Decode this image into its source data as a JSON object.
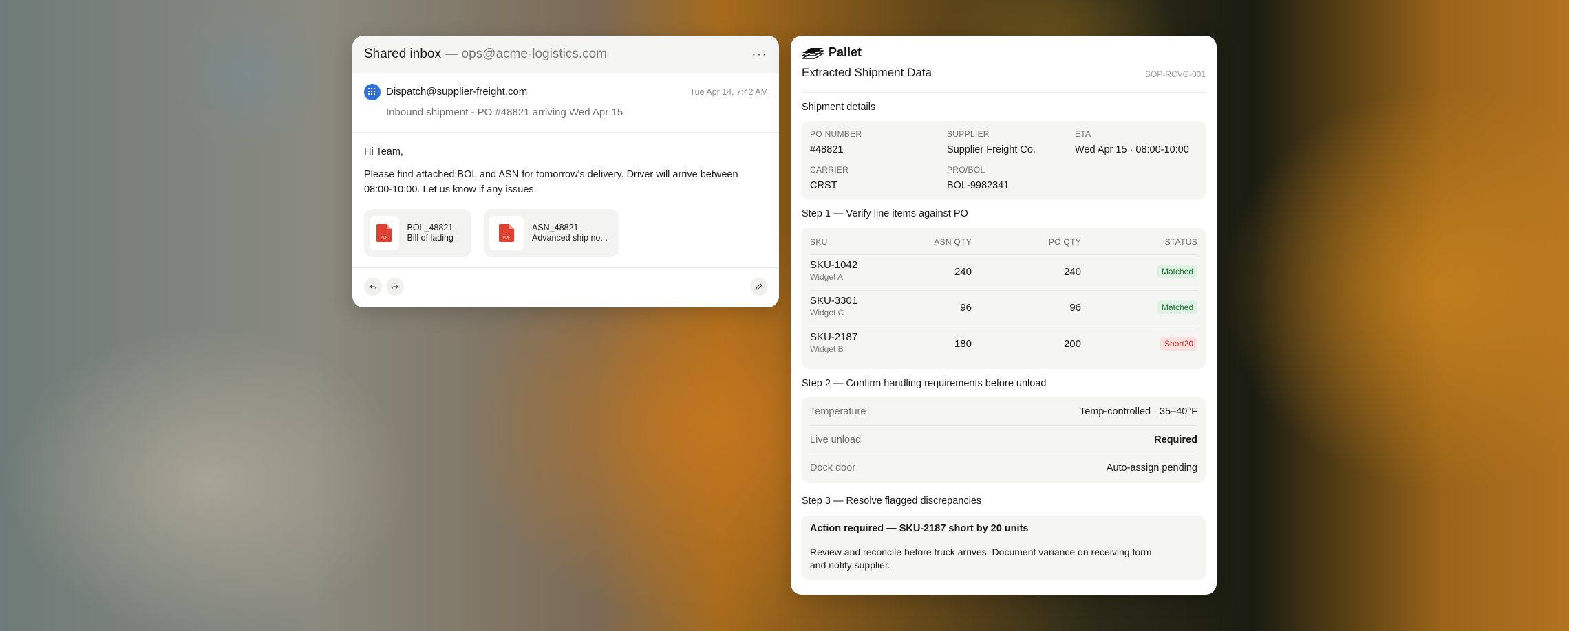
{
  "email": {
    "header_prefix": "Shared inbox — ",
    "header_address": "ops@acme-logistics.com",
    "more_label": "···",
    "sender": "Dispatch@supplier-freight.com",
    "time": "Tue Apr 14, 7:42 AM",
    "subject": "Inbound shipment - PO #48821 arriving Wed Apr 15",
    "greeting": "Hi Team,",
    "body": "Please find attached BOL and ASN for tomorrow's delivery. Driver will arrive between 08:00-10:00. Let us know if any issues.",
    "attachments": [
      {
        "line1": "BOL_48821-",
        "line2": "Bill of lading",
        "icon": "pdf-icon"
      },
      {
        "line1": "ASN_48821-",
        "line2": "Advanced ship no...",
        "icon": "pdf-icon"
      }
    ],
    "pdf_tag": "PDF",
    "accent_color": "#2f6fd8",
    "pdf_color": "#e0402f"
  },
  "extraction": {
    "brand": "Pallet",
    "title": "Extracted Shipment Data",
    "doc_id": "SOP-RCVG-001",
    "shipment_label": "Shipment details",
    "fields": {
      "po_label": "PO NUMBER",
      "po_value": "#48821",
      "supplier_label": "SUPPLIER",
      "supplier_value": "Supplier Freight Co.",
      "eta_label": "ETA",
      "eta_value": "Wed Apr 15 · 08:00-10:00",
      "carrier_label": "CARRIER",
      "carrier_value": "CRST",
      "pro_label": "PRO/BOL",
      "pro_value": "BOL-9982341"
    },
    "step1_label": "Step 1 — Verify line items against PO",
    "table": {
      "headers": [
        "SKU",
        "ASN QTY",
        "PO QTY",
        "STATUS"
      ],
      "rows": [
        {
          "sku": "SKU-1042",
          "name": "Widget A",
          "asn": "240",
          "po": "240",
          "status": "Matched",
          "state": "ok"
        },
        {
          "sku": "SKU-3301",
          "name": "Widget C",
          "asn": "96",
          "po": "96",
          "status": "Matched",
          "state": "ok"
        },
        {
          "sku": "SKU-2187",
          "name": "Widget B",
          "asn": "180",
          "po": "200",
          "status": "Short20",
          "state": "bad"
        }
      ]
    },
    "step2_label": "Step 2 — Confirm handling requirements before unload",
    "handling": [
      {
        "key": "Temperature",
        "value": "Temp-controlled · 35–40°F"
      },
      {
        "key": "Live unload",
        "value": "Required"
      },
      {
        "key": "Dock door",
        "value": "Auto-assign pending"
      }
    ],
    "step3_label": "Step 3 — Resolve flagged discrepancies",
    "action_title": "Action required — SKU-2187 short by 20 units",
    "action_body": "Review and reconcile before truck arrives. Document variance on receiving form and notify supplier."
  }
}
